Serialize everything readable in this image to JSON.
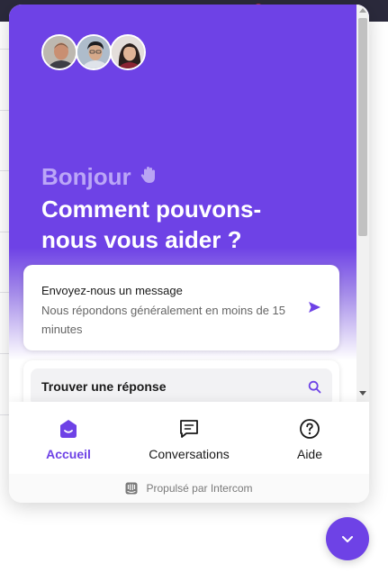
{
  "header": {
    "greeting": "Bonjour",
    "wave_icon": "waving-hand-icon",
    "headline": "Comment pouvons-nous vous aider ?"
  },
  "message_card": {
    "title": "Envoyez-nous un message",
    "subtitle": "Nous répondons généralement en moins de 15 minutes",
    "icon": "send-icon"
  },
  "search_card": {
    "label": "Trouver une réponse",
    "icon": "search-icon"
  },
  "nav": {
    "items": [
      {
        "label": "Accueil",
        "icon": "home-icon",
        "active": true
      },
      {
        "label": "Conversations",
        "icon": "chat-icon",
        "active": false
      },
      {
        "label": "Aide",
        "icon": "help-icon",
        "active": false
      }
    ]
  },
  "footer": {
    "text": "Propulsé par Intercom",
    "icon": "intercom-logo-icon"
  },
  "launcher": {
    "icon": "chevron-down-icon"
  },
  "colors": {
    "brand": "#6e42e6",
    "greeting": "#bba6f7",
    "text": "#1a1a1a",
    "muted": "#666666"
  }
}
